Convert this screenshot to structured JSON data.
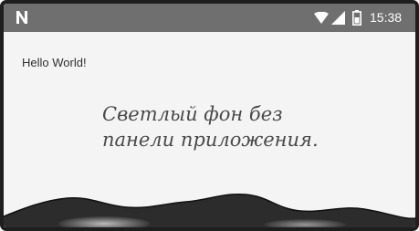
{
  "status_bar": {
    "notification_icon": "n-notification-icon",
    "wifi_icon": "wifi-icon",
    "signal_icon": "cell-signal-icon",
    "battery_icon": "battery-icon",
    "time": "15:38",
    "colors": {
      "background": "#6f6f6f",
      "foreground": "#ffffff"
    }
  },
  "content": {
    "hello_text": "Hello World!",
    "annotation_line1": "Светлый фон без",
    "annotation_line2": "панели приложения.",
    "colors": {
      "background": "#f4f4f4",
      "text": "#303030",
      "annotation": "#4a4a4a"
    }
  }
}
